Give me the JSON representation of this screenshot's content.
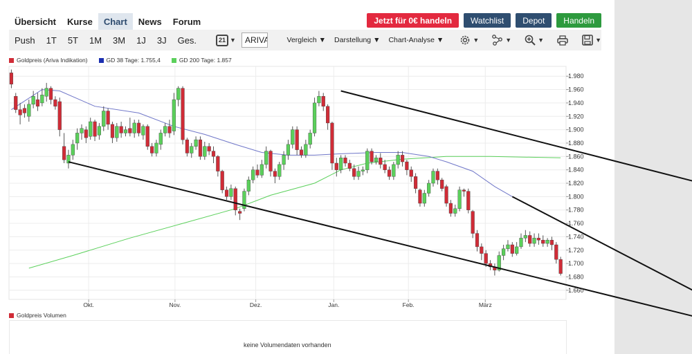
{
  "nav": {
    "tabs": [
      {
        "label": "Übersicht",
        "active": false
      },
      {
        "label": "Kurse",
        "active": false
      },
      {
        "label": "Chart",
        "active": true
      },
      {
        "label": "News",
        "active": false
      },
      {
        "label": "Forum",
        "active": false
      }
    ]
  },
  "actions": {
    "trade": {
      "label": "Jetzt für 0€ handeln",
      "color": "#e3293f"
    },
    "watchlist": {
      "label": "Watchlist",
      "color": "#2f4e70"
    },
    "depot": {
      "label": "Depot",
      "color": "#2f4e70"
    },
    "handeln": {
      "label": "Handeln",
      "color": "#2d9a3e"
    }
  },
  "toolbar": {
    "periods": [
      "Push",
      "1T",
      "5T",
      "1M",
      "3M",
      "1J",
      "3J",
      "Ges."
    ],
    "calendar_day": "21",
    "exchange_select": "ARIVA Indi",
    "menus": [
      "Vergleich",
      "Darstellung",
      "Chart-Analyse"
    ],
    "icons": [
      "settings-gear-icon",
      "indicators-icon",
      "zoom-in-icon",
      "print-icon",
      "save-disk-icon"
    ]
  },
  "legend": [
    {
      "label": "Goldpreis (Ariva Indikation)",
      "color": "#d02c37"
    },
    {
      "label": "GD 38 Tage: 1.755,4",
      "color": "#1b2fb0"
    },
    {
      "label": "GD 200 Tage: 1.857",
      "color": "#5bd05b"
    }
  ],
  "chart_data": {
    "type": "candlestick",
    "y_ticks": [
      "1.980",
      "1.960",
      "1.940",
      "1.920",
      "1.900",
      "1.880",
      "1.860",
      "1.840",
      "1.820",
      "1.800",
      "1.780",
      "1.760",
      "1.740",
      "1.720",
      "1.700",
      "1.680",
      "1.660"
    ],
    "ylim": [
      1655,
      1990
    ],
    "x_months": [
      "Okt.",
      "Nov.",
      "Dez.",
      "Jan.",
      "Feb.",
      "März"
    ],
    "x_month_pos": [
      0.143,
      0.298,
      0.443,
      0.583,
      0.717,
      0.855
    ],
    "grid": true,
    "candles": [
      [
        1.0,
        1985,
        1968,
        1990,
        1962
      ],
      [
        2.0,
        1950,
        1930,
        1955,
        1925
      ],
      [
        3.0,
        1930,
        1922,
        1940,
        1908
      ],
      [
        4.0,
        1932,
        1925,
        1938,
        1918
      ],
      [
        5.0,
        1920,
        1938,
        1945,
        1912
      ],
      [
        6.0,
        1938,
        1950,
        1958,
        1932
      ],
      [
        7.0,
        1945,
        1935,
        1955,
        1928
      ],
      [
        8.0,
        1940,
        1952,
        1962,
        1935
      ],
      [
        9.0,
        1950,
        1962,
        1970,
        1942
      ],
      [
        10.0,
        1962,
        1945,
        1965,
        1938
      ],
      [
        11.0,
        1945,
        1935,
        1950,
        1930
      ],
      [
        12.0,
        1942,
        1900,
        1948,
        1890
      ],
      [
        13.0,
        1875,
        1855,
        1895,
        1850
      ],
      [
        14.0,
        1850,
        1862,
        1870,
        1842
      ],
      [
        15.0,
        1862,
        1878,
        1885,
        1855
      ],
      [
        16.0,
        1880,
        1895,
        1902,
        1870
      ],
      [
        17.0,
        1895,
        1902,
        1908,
        1885
      ],
      [
        18.0,
        1900,
        1888,
        1905,
        1880
      ],
      [
        19.0,
        1890,
        1912,
        1918,
        1885
      ],
      [
        20.0,
        1912,
        1890,
        1915,
        1883
      ],
      [
        21.0,
        1892,
        1905,
        1910,
        1885
      ],
      [
        22.0,
        1905,
        1928,
        1935,
        1898
      ],
      [
        23.0,
        1928,
        1908,
        1932,
        1900
      ],
      [
        24.0,
        1908,
        1888,
        1912,
        1880
      ],
      [
        25.0,
        1888,
        1905,
        1910,
        1882
      ],
      [
        26.0,
        1905,
        1895,
        1912,
        1888
      ],
      [
        27.0,
        1895,
        1900,
        1905,
        1890
      ],
      [
        28.0,
        1902,
        1895,
        1918,
        1890
      ],
      [
        29.0,
        1895,
        1910,
        1915,
        1888
      ],
      [
        30.0,
        1910,
        1895,
        1915,
        1890
      ],
      [
        31.0,
        1892,
        1905,
        1908,
        1885
      ],
      [
        32.0,
        1905,
        1875,
        1908,
        1870
      ],
      [
        33.0,
        1875,
        1865,
        1880,
        1860
      ],
      [
        34.0,
        1865,
        1880,
        1885,
        1860
      ],
      [
        35.0,
        1878,
        1895,
        1900,
        1870
      ],
      [
        36.0,
        1895,
        1905,
        1910,
        1890
      ],
      [
        37.0,
        1905,
        1895,
        1915,
        1888
      ],
      [
        38.0,
        1898,
        1945,
        1955,
        1892
      ],
      [
        39.0,
        1945,
        1962,
        1965,
        1935
      ],
      [
        40.0,
        1962,
        1885,
        1965,
        1878
      ],
      [
        41.0,
        1885,
        1865,
        1888,
        1860
      ],
      [
        42.0,
        1865,
        1875,
        1880,
        1858
      ],
      [
        43.0,
        1875,
        1885,
        1890,
        1870
      ],
      [
        44.0,
        1885,
        1860,
        1890,
        1855
      ],
      [
        45.0,
        1860,
        1875,
        1882,
        1855
      ],
      [
        46.0,
        1875,
        1868,
        1880,
        1862
      ],
      [
        47.0,
        1868,
        1860,
        1875,
        1850
      ],
      [
        48.0,
        1860,
        1838,
        1862,
        1830
      ],
      [
        49.0,
        1838,
        1810,
        1840,
        1805
      ],
      [
        50.0,
        1810,
        1800,
        1815,
        1795
      ],
      [
        51.0,
        1800,
        1812,
        1818,
        1795
      ],
      [
        52.0,
        1812,
        1780,
        1815,
        1772
      ],
      [
        53.0,
        1778,
        1775,
        1782,
        1765
      ],
      [
        54.0,
        1782,
        1808,
        1812,
        1778
      ],
      [
        55.0,
        1808,
        1825,
        1830,
        1802
      ],
      [
        56.0,
        1825,
        1840,
        1845,
        1820
      ],
      [
        57.0,
        1840,
        1832,
        1848,
        1828
      ],
      [
        58.0,
        1832,
        1848,
        1855,
        1828
      ],
      [
        59.0,
        1848,
        1868,
        1875,
        1842
      ],
      [
        60.0,
        1868,
        1838,
        1870,
        1830
      ],
      [
        61.0,
        1838,
        1830,
        1842,
        1820
      ],
      [
        62.0,
        1830,
        1848,
        1852,
        1825
      ],
      [
        63.0,
        1848,
        1862,
        1868,
        1840
      ],
      [
        64.0,
        1862,
        1878,
        1885,
        1855
      ],
      [
        65.0,
        1878,
        1900,
        1905,
        1872
      ],
      [
        66.0,
        1900,
        1870,
        1905,
        1862
      ],
      [
        67.0,
        1870,
        1862,
        1875,
        1858
      ],
      [
        68.0,
        1862,
        1878,
        1885,
        1858
      ],
      [
        69.0,
        1878,
        1895,
        1900,
        1872
      ],
      [
        70.0,
        1895,
        1940,
        1948,
        1890
      ],
      [
        71.0,
        1940,
        1950,
        1958,
        1935
      ],
      [
        72.0,
        1950,
        1935,
        1955,
        1928
      ],
      [
        73.0,
        1935,
        1910,
        1938,
        1900
      ],
      [
        74.0,
        1910,
        1850,
        1912,
        1840
      ],
      [
        75.0,
        1850,
        1840,
        1858,
        1830
      ],
      [
        76.0,
        1840,
        1858,
        1862,
        1835
      ],
      [
        77.0,
        1858,
        1850,
        1862,
        1845
      ],
      [
        78.0,
        1850,
        1842,
        1855,
        1838
      ],
      [
        79.0,
        1842,
        1830,
        1848,
        1825
      ],
      [
        80.0,
        1830,
        1838,
        1845,
        1825
      ],
      [
        81.0,
        1838,
        1840,
        1845,
        1832
      ],
      [
        82.0,
        1840,
        1868,
        1872,
        1835
      ],
      [
        83.0,
        1868,
        1852,
        1872,
        1848
      ],
      [
        84.0,
        1852,
        1858,
        1862,
        1848
      ],
      [
        85.0,
        1858,
        1848,
        1865,
        1842
      ],
      [
        86.0,
        1848,
        1840,
        1855,
        1835
      ],
      [
        87.0,
        1840,
        1830,
        1845,
        1825
      ],
      [
        88.0,
        1830,
        1848,
        1852,
        1825
      ],
      [
        89.0,
        1848,
        1862,
        1868,
        1842
      ],
      [
        90.0,
        1862,
        1852,
        1868,
        1845
      ],
      [
        91.0,
        1852,
        1840,
        1855,
        1832
      ],
      [
        92.0,
        1840,
        1830,
        1845,
        1822
      ],
      [
        93.0,
        1830,
        1812,
        1835,
        1805
      ],
      [
        94.0,
        1810,
        1790,
        1812,
        1785
      ],
      [
        95.0,
        1790,
        1805,
        1810,
        1785
      ],
      [
        96.0,
        1805,
        1820,
        1825,
        1800
      ],
      [
        97.0,
        1820,
        1838,
        1842,
        1815
      ],
      [
        98.0,
        1838,
        1825,
        1842,
        1818
      ],
      [
        99.0,
        1825,
        1812,
        1828,
        1808
      ],
      [
        100.0,
        1815,
        1790,
        1818,
        1785
      ],
      [
        101.0,
        1790,
        1775,
        1795,
        1770
      ],
      [
        102.0,
        1775,
        1782,
        1788,
        1770
      ],
      [
        103.0,
        1782,
        1810,
        1815,
        1778
      ],
      [
        104.0,
        1810,
        1808,
        1812,
        1800
      ],
      [
        105.0,
        1808,
        1780,
        1812,
        1775
      ],
      [
        106.0,
        1778,
        1745,
        1780,
        1738
      ],
      [
        107.0,
        1745,
        1725,
        1750,
        1718
      ],
      [
        108.0,
        1725,
        1715,
        1730,
        1705
      ],
      [
        109.0,
        1715,
        1700,
        1720,
        1695
      ],
      [
        110.0,
        1700,
        1695,
        1705,
        1690
      ],
      [
        111.0,
        1695,
        1690,
        1700,
        1682
      ],
      [
        112.0,
        1690,
        1712,
        1718,
        1688
      ],
      [
        113.0,
        1712,
        1722,
        1728,
        1705
      ],
      [
        114.0,
        1722,
        1728,
        1735,
        1718
      ],
      [
        115.0,
        1728,
        1715,
        1732,
        1710
      ],
      [
        116.0,
        1715,
        1725,
        1732,
        1712
      ],
      [
        117.0,
        1725,
        1738,
        1745,
        1722
      ],
      [
        118.0,
        1738,
        1742,
        1750,
        1732
      ],
      [
        119.0,
        1742,
        1730,
        1748,
        1725
      ],
      [
        120.0,
        1730,
        1738,
        1745,
        1725
      ],
      [
        121.0,
        1738,
        1735,
        1745,
        1728
      ],
      [
        122.0,
        1735,
        1730,
        1742,
        1725
      ],
      [
        123.0,
        1730,
        1735,
        1738,
        1725
      ],
      [
        124.0,
        1735,
        1728,
        1740,
        1720
      ],
      [
        125.0,
        1728,
        1706,
        1732,
        1700
      ],
      [
        126.0,
        1706,
        1685,
        1710,
        1682
      ]
    ],
    "gd38": [
      [
        1.0,
        1930
      ],
      [
        8.0,
        1960
      ],
      [
        12.0,
        1958
      ],
      [
        20.0,
        1935
      ],
      [
        30.0,
        1925
      ],
      [
        38.0,
        1905
      ],
      [
        45.0,
        1893
      ],
      [
        52.0,
        1878
      ],
      [
        58.0,
        1866
      ],
      [
        64.0,
        1862
      ],
      [
        70.0,
        1862
      ],
      [
        76.0,
        1864
      ],
      [
        84.0,
        1866
      ],
      [
        90.0,
        1866
      ],
      [
        96.0,
        1860
      ],
      [
        100.0,
        1852
      ],
      [
        106.0,
        1838
      ],
      [
        111.0,
        1815
      ],
      [
        115.0,
        1800
      ]
    ],
    "gd200": [
      [
        5.0,
        1693
      ],
      [
        15.0,
        1712
      ],
      [
        28.0,
        1738
      ],
      [
        40.0,
        1760
      ],
      [
        52.0,
        1782
      ],
      [
        60.0,
        1802
      ],
      [
        70.0,
        1820
      ],
      [
        76.0,
        1840
      ],
      [
        82.0,
        1850
      ],
      [
        90.0,
        1856
      ],
      [
        100.0,
        1860
      ],
      [
        110.0,
        1860
      ],
      [
        126.0,
        1858
      ]
    ],
    "trendlines": [
      {
        "x1": 76.0,
        "y1": 1958,
        "x2": 164.0,
        "y2": 1810
      },
      {
        "x1": 14.0,
        "y1": 1852,
        "x2": 160.0,
        "y2": 1615
      },
      {
        "x1": 115.0,
        "y1": 1800,
        "x2": 159.0,
        "y2": 1650
      }
    ]
  },
  "volume": {
    "title": "Goldpreis Volumen",
    "color": "#d02c37",
    "message": "keine Volumendaten vorhanden"
  }
}
